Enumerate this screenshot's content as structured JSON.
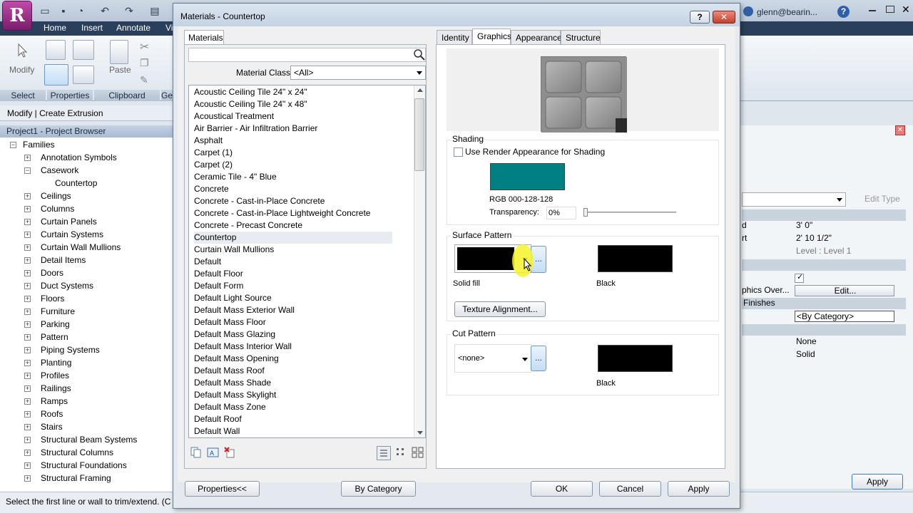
{
  "app": {
    "logo_letter": "R",
    "user": "glenn@bearin...",
    "help": "?",
    "ribbon_tabs": [
      "Home",
      "Insert",
      "Annotate",
      "Vi"
    ],
    "ribbon_buttons": {
      "modify": "Modify",
      "paste": "Paste"
    },
    "ribbon_panels": [
      "Select",
      "Properties",
      "Clipboard",
      "Ge"
    ],
    "context_bar": "Modify | Create Extrusion",
    "status_text": "Select the first line or wall to trim/extend. (C"
  },
  "project_browser": {
    "title": "Project1 - Project Browser",
    "root": "Families",
    "items": [
      "Annotation Symbols",
      "Casework",
      "Ceilings",
      "Columns",
      "Curtain Panels",
      "Curtain Systems",
      "Curtain Wall Mullions",
      "Detail Items",
      "Doors",
      "Duct Systems",
      "Floors",
      "Furniture",
      "Parking",
      "Pattern",
      "Piping Systems",
      "Planting",
      "Profiles",
      "Railings",
      "Ramps",
      "Roofs",
      "Stairs",
      "Structural Beam Systems",
      "Structural Columns",
      "Structural Foundations",
      "Structural Framing"
    ],
    "casework_child": "Countertop"
  },
  "properties_right": {
    "edit_type": "Edit Type",
    "rows": [
      {
        "label": "d",
        "value": "3'  0\""
      },
      {
        "label": "rt",
        "value": "2'  10 1/2\""
      },
      {
        "label": "",
        "value": "Level : Level 1"
      },
      {
        "label": "phics Over...",
        "value": "Edit..."
      },
      {
        "label": "Finishes",
        "value": ""
      },
      {
        "label": "",
        "value": "<By Category>"
      },
      {
        "label": "",
        "value": "None"
      },
      {
        "label": "",
        "value": "Solid"
      }
    ],
    "apply": "Apply"
  },
  "dialog": {
    "title": "Materials - Countertop",
    "help_btn": "?",
    "close_btn": "✕",
    "materials_tab": "Materials",
    "search_placeholder": "",
    "material_class_label": "Material Class:",
    "material_class_value": "<All>",
    "materials": [
      "Acoustic Ceiling Tile 24\" x 24\"",
      "Acoustic Ceiling Tile 24\" x 48\"",
      "Acoustical Treatment",
      "Air Barrier - Air Infiltration Barrier",
      "Asphalt",
      "Carpet (1)",
      "Carpet (2)",
      "Ceramic Tile - 4\" Blue",
      "Concrete",
      "Concrete - Cast-in-Place Concrete",
      "Concrete - Cast-in-Place Lightweight Concrete",
      "Concrete - Precast Concrete",
      "Countertop",
      "Curtain Wall Mullions",
      "Default",
      "Default Floor",
      "Default Form",
      "Default Light Source",
      "Default Mass Exterior Wall",
      "Default Mass Floor",
      "Default Mass Glazing",
      "Default Mass Interior Wall",
      "Default Mass Opening",
      "Default Mass Roof",
      "Default Mass Shade",
      "Default Mass Skylight",
      "Default Mass Zone",
      "Default Roof",
      "Default Wall"
    ],
    "selected_material": "Countertop",
    "tabs": [
      "Identity",
      "Graphics",
      "Appearance",
      "Structure"
    ],
    "active_tab": "Graphics",
    "shading": {
      "title": "Shading",
      "use_render_label": "Use Render Appearance for Shading",
      "use_render_checked": false,
      "color": "#008080",
      "rgb_text": "RGB 000-128-128",
      "transparency_label": "Transparency:",
      "transparency_value": "0%"
    },
    "surface_pattern": {
      "title": "Surface Pattern",
      "pattern_name": "Solid fill",
      "color_name": "Black",
      "color": "#000000",
      "texture_btn": "Texture Alignment...",
      "ellipsis": "..."
    },
    "cut_pattern": {
      "title": "Cut Pattern",
      "pattern_value": "<none>",
      "color_name": "Black",
      "color": "#000000",
      "ellipsis": "..."
    },
    "footer": {
      "properties_btn": "Properties<<",
      "by_category_btn": "By Category",
      "ok": "OK",
      "cancel": "Cancel",
      "apply": "Apply"
    }
  }
}
